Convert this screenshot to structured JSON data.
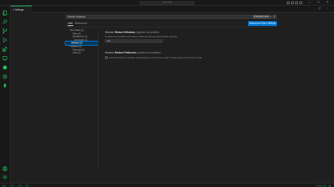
{
  "titlebar": {
    "title": "[untitled]",
    "min_glyph": "—",
    "max_glyph": "☐",
    "close_glyph": "✕"
  },
  "activity_bar": {
    "accent_color": "#22c55e",
    "top_items": [
      {
        "name": "explorer-icon",
        "icon": "files"
      },
      {
        "name": "search-icon",
        "icon": "search"
      },
      {
        "name": "source-control-icon",
        "icon": "branch"
      },
      {
        "name": "run-debug-icon",
        "icon": "play"
      },
      {
        "name": "extensions-icon",
        "icon": "blocks"
      },
      {
        "name": "remote-explorer-icon",
        "icon": "monitor"
      },
      {
        "name": "testing-icon",
        "icon": "flask"
      },
      {
        "name": "accounts-manager-icon",
        "icon": "people"
      },
      {
        "name": "leaf-icon",
        "icon": "leaf"
      }
    ],
    "bottom_items": [
      {
        "name": "accounts-icon",
        "icon": "person"
      },
      {
        "name": "manage-gear-icon",
        "icon": "gear"
      }
    ]
  },
  "editor": {
    "tab_label": "Settings",
    "tab_icon": "≡"
  },
  "settings": {
    "search_value": "Restore Windows",
    "found_badge": "6 Settings Found",
    "clear_glyph": "≡",
    "filter_glyph": "⊽",
    "scope_tabs": [
      {
        "label": "User",
        "active": true
      },
      {
        "label": "Workspace",
        "active": false
      }
    ],
    "backup_button": "Backup and Sync Settings",
    "toc": [
      {
        "label": "Text Editor (1)",
        "level": 0,
        "expanded": true,
        "selected": false
      },
      {
        "label": "Files (1)",
        "level": 1,
        "expanded": null,
        "selected": false
      },
      {
        "label": "Workbench (1)",
        "level": 0,
        "expanded": true,
        "selected": false
      },
      {
        "label": "Zen Mode (1)",
        "level": 1,
        "expanded": null,
        "selected": false
      },
      {
        "label": "Window (2)",
        "level": 0,
        "expanded": null,
        "selected": true
      },
      {
        "label": "Features (1)",
        "level": 0,
        "expanded": true,
        "selected": false
      },
      {
        "label": "Terminal (1)",
        "level": 1,
        "expanded": null,
        "selected": false
      },
      {
        "label": "Chat (1)",
        "level": 1,
        "expanded": null,
        "selected": false
      }
    ],
    "items": [
      {
        "prefix": "Window: ",
        "bold": "Restore Windows",
        "scope": " (Applies to all profiles)",
        "description": "Controls how windows and editors within are being restored when opening.",
        "control": "select",
        "value": "one"
      },
      {
        "prefix": "Window: ",
        "bold": "Restore Fullscreen",
        "scope": " (Applies to all profiles)",
        "description": "Controls whether a window should restore to full screen mode if it was exited in full screen mode.",
        "control": "checkbox",
        "checked": false
      }
    ]
  },
  "status_bar": {
    "left": [
      "⊗ 0",
      "⚠ 0",
      "⓪ 0",
      "⚲ 0"
    ],
    "right": "⊙ Go Live",
    "bell": "🔔︎"
  }
}
